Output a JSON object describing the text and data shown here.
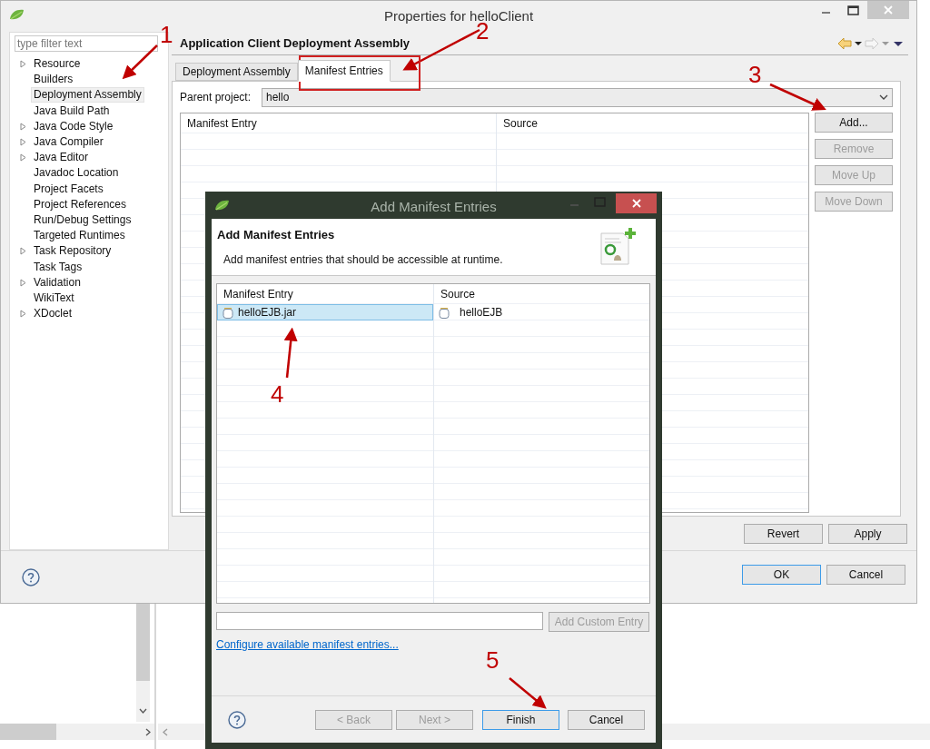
{
  "window": {
    "title": "Properties for helloClient"
  },
  "sidebar": {
    "filter_placeholder": "type filter text",
    "items": [
      {
        "label": "Resource",
        "expandable": true,
        "selected": false
      },
      {
        "label": "Builders",
        "expandable": false,
        "selected": false
      },
      {
        "label": "Deployment Assembly",
        "expandable": false,
        "selected": true
      },
      {
        "label": "Java Build Path",
        "expandable": false,
        "selected": false
      },
      {
        "label": "Java Code Style",
        "expandable": true,
        "selected": false
      },
      {
        "label": "Java Compiler",
        "expandable": true,
        "selected": false
      },
      {
        "label": "Java Editor",
        "expandable": true,
        "selected": false
      },
      {
        "label": "Javadoc Location",
        "expandable": false,
        "selected": false
      },
      {
        "label": "Project Facets",
        "expandable": false,
        "selected": false
      },
      {
        "label": "Project References",
        "expandable": false,
        "selected": false
      },
      {
        "label": "Run/Debug Settings",
        "expandable": false,
        "selected": false
      },
      {
        "label": "Targeted Runtimes",
        "expandable": false,
        "selected": false
      },
      {
        "label": "Task Repository",
        "expandable": true,
        "selected": false
      },
      {
        "label": "Task Tags",
        "expandable": false,
        "selected": false
      },
      {
        "label": "Validation",
        "expandable": true,
        "selected": false
      },
      {
        "label": "WikiText",
        "expandable": false,
        "selected": false
      },
      {
        "label": "XDoclet",
        "expandable": true,
        "selected": false
      }
    ]
  },
  "page": {
    "title": "Application Client Deployment Assembly",
    "tabs": [
      {
        "label": "Deployment Assembly",
        "selected": false
      },
      {
        "label": "Manifest Entries",
        "selected": true
      }
    ],
    "parent_project": {
      "label": "Parent project:",
      "value": "hello"
    },
    "table": {
      "columns": [
        "Manifest Entry",
        "Source"
      ]
    },
    "side_buttons": [
      {
        "label": "Add...",
        "disabled": false
      },
      {
        "label": "Remove",
        "disabled": true
      },
      {
        "label": "Move Up",
        "disabled": true
      },
      {
        "label": "Move Down",
        "disabled": true
      }
    ],
    "apply_buttons": [
      "Revert",
      "Apply"
    ]
  },
  "footer_buttons": [
    {
      "label": "OK",
      "default": true
    },
    {
      "label": "Cancel",
      "default": false
    }
  ],
  "dialog": {
    "title": "Add Manifest Entries",
    "heading": "Add Manifest Entries",
    "description": "Add manifest entries that should be accessible at runtime.",
    "table": {
      "columns": [
        "Manifest Entry",
        "Source"
      ],
      "rows": [
        {
          "entry": "helloEJB.jar",
          "source": "helloEJB",
          "selected": true
        }
      ]
    },
    "custom_entry_button": {
      "label": "Add Custom Entry",
      "disabled": true
    },
    "link": "Configure available manifest entries...",
    "buttons": [
      {
        "label": "< Back",
        "disabled": true,
        "default": false
      },
      {
        "label": "Next >",
        "disabled": true,
        "default": false
      },
      {
        "label": "Finish",
        "disabled": false,
        "default": true
      },
      {
        "label": "Cancel",
        "disabled": false,
        "default": false
      }
    ]
  },
  "annotations": [
    "1",
    "2",
    "3",
    "4",
    "5"
  ]
}
